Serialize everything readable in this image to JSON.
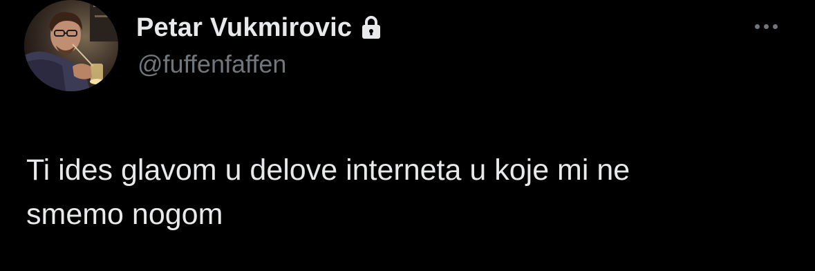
{
  "tweet": {
    "author": {
      "display_name": "Petar Vukmirovic",
      "handle": "@fuffenfaffen",
      "avatar_icon": "profile-photo",
      "protected_icon": "lock-icon"
    },
    "more_icon": "more-horizontal-icon",
    "text_line_1": "Ti ides glavom u delove interneta u koje mi ne",
    "text_line_2": "smemo nogom"
  },
  "colors": {
    "background": "#000000",
    "primary_text": "#e7e9ea",
    "secondary_text": "#71767b"
  }
}
